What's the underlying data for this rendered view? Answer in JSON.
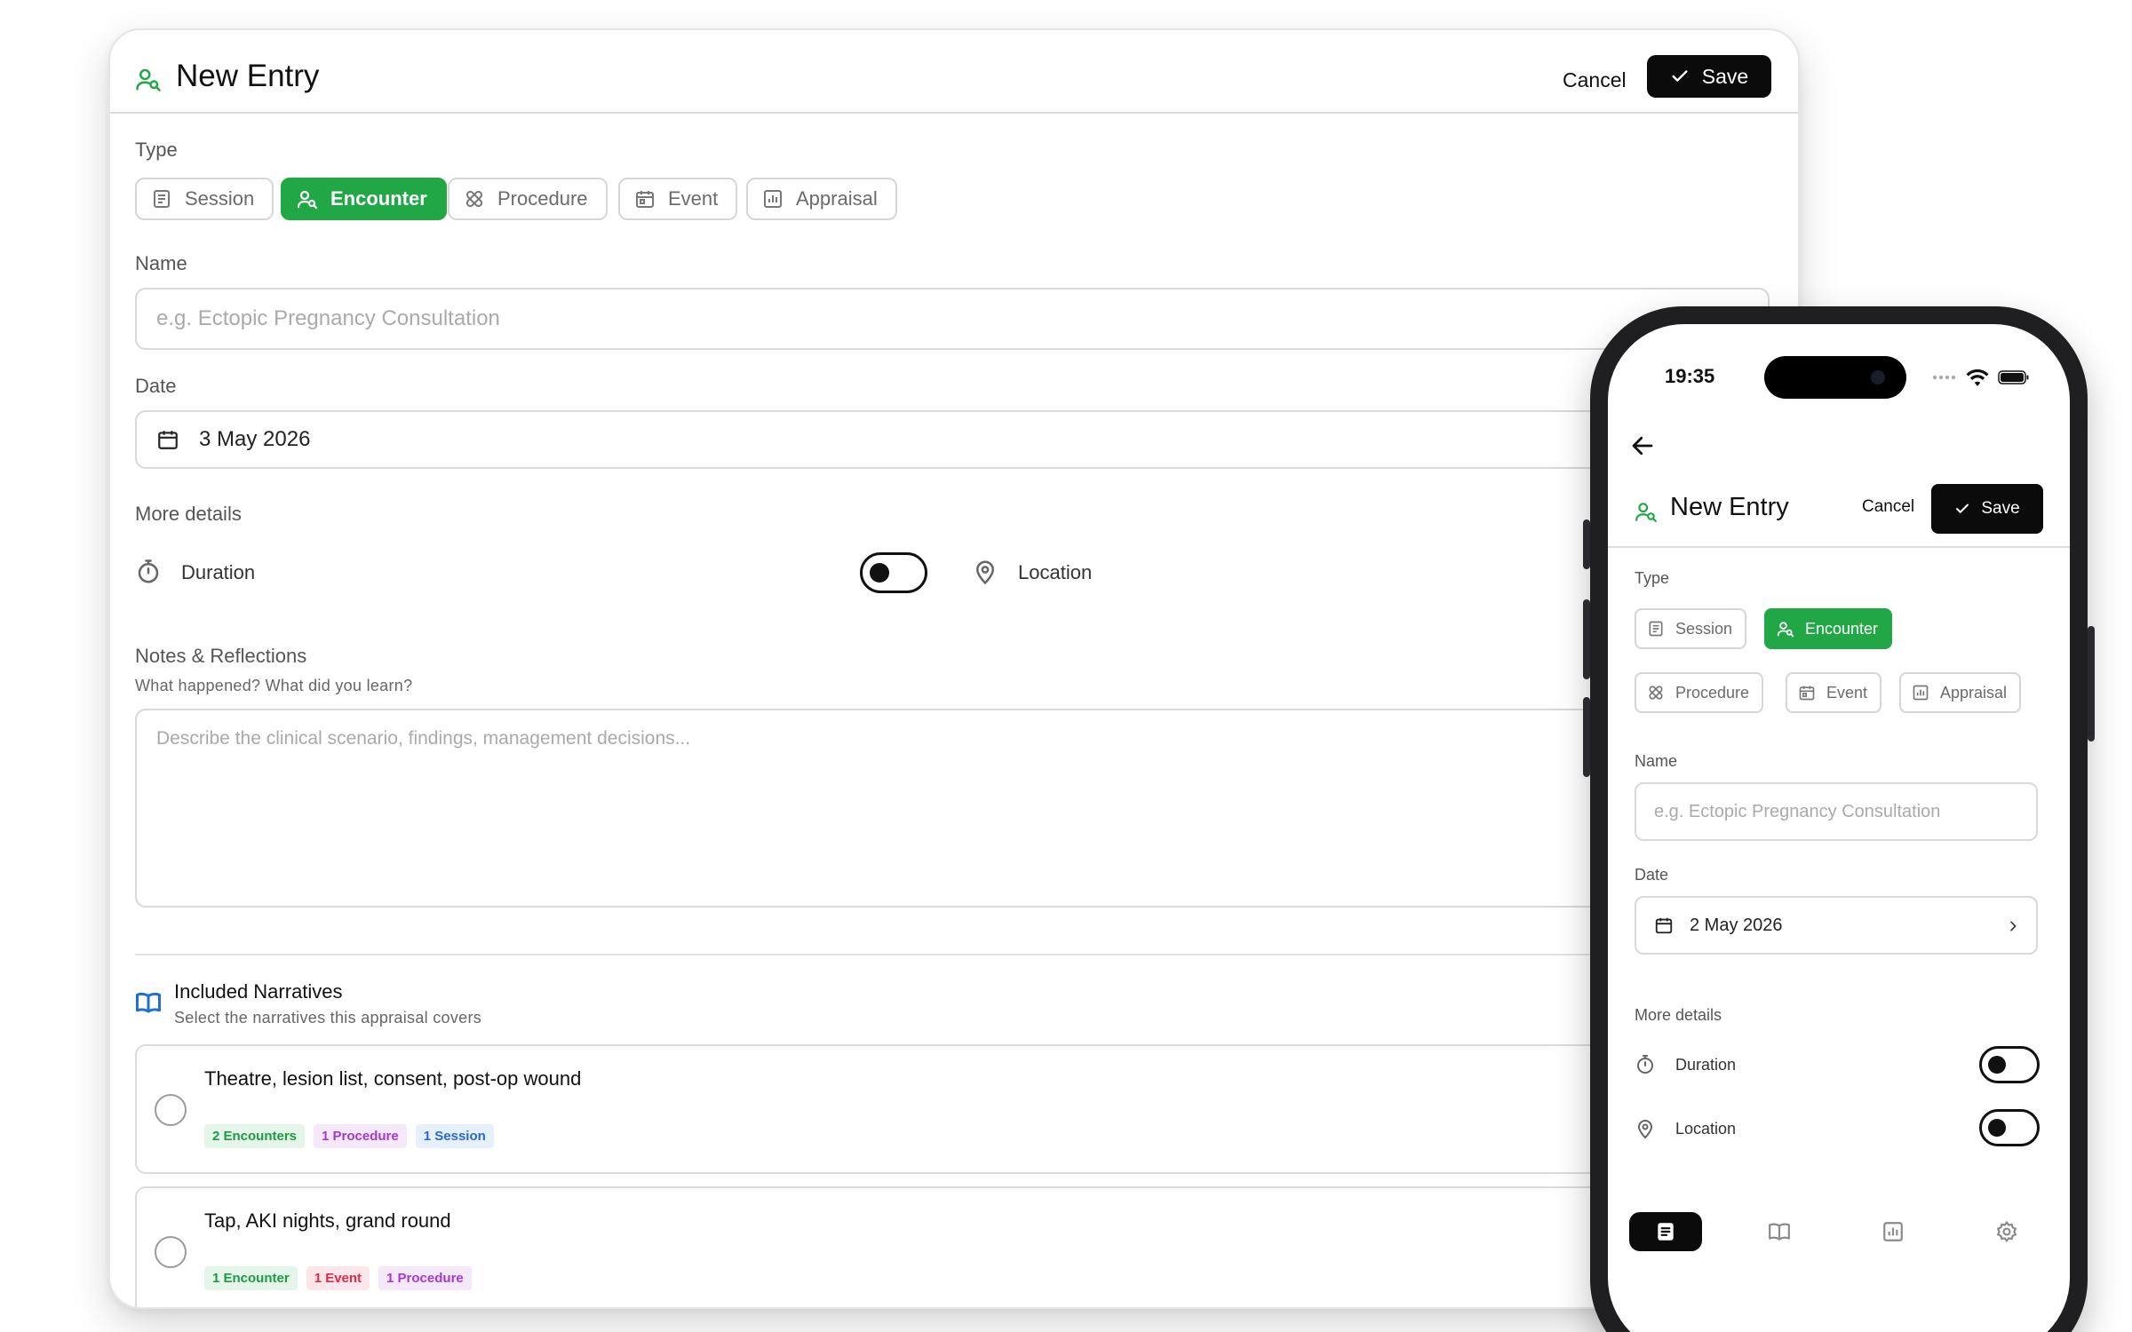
{
  "desktop": {
    "title": "New Entry",
    "cancel_label": "Cancel",
    "save_label": "Save",
    "type_label": "Type",
    "types": [
      "Session",
      "Encounter",
      "Procedure",
      "Event",
      "Appraisal"
    ],
    "active_type": "Encounter",
    "name_label": "Name",
    "name_placeholder": "e.g. Ectopic Pregnancy Consultation",
    "date_label": "Date",
    "date_value": "3 May 2026",
    "more_details_label": "More details",
    "duration_label": "Duration",
    "location_label": "Location",
    "notes_label": "Notes & Reflections",
    "notes_hint": "What happened? What did you learn?",
    "notes_placeholder": "Describe the clinical scenario, findings, management decisions...",
    "narratives_title": "Included Narratives",
    "narratives_hint": "Select the narratives this appraisal covers",
    "narratives": [
      {
        "title": "Theatre, lesion list, consent, post-op wound",
        "tags": [
          "2 Encounters",
          "1 Procedure",
          "1 Session"
        ]
      },
      {
        "title": "Tap, AKI nights, grand round",
        "tags": [
          "1 Encounter",
          "1 Event",
          "1 Procedure"
        ]
      }
    ]
  },
  "phone": {
    "time": "19:35",
    "title": "New Entry",
    "cancel_label": "Cancel",
    "save_label": "Save",
    "type_label": "Type",
    "types": [
      "Session",
      "Encounter",
      "Procedure",
      "Event",
      "Appraisal"
    ],
    "active_type": "Encounter",
    "name_label": "Name",
    "name_placeholder": "e.g. Ectopic Pregnancy Consultation",
    "date_label": "Date",
    "date_value": "2 May 2026",
    "more_details_label": "More details",
    "duration_label": "Duration",
    "location_label": "Location",
    "tabs": [
      "entries-icon",
      "narratives-icon",
      "appraisal-icon",
      "settings-icon"
    ]
  },
  "colors": {
    "accent": "#22a746",
    "primary_button": "#0b0b0b",
    "narratives_icon": "#1f6fd1"
  }
}
